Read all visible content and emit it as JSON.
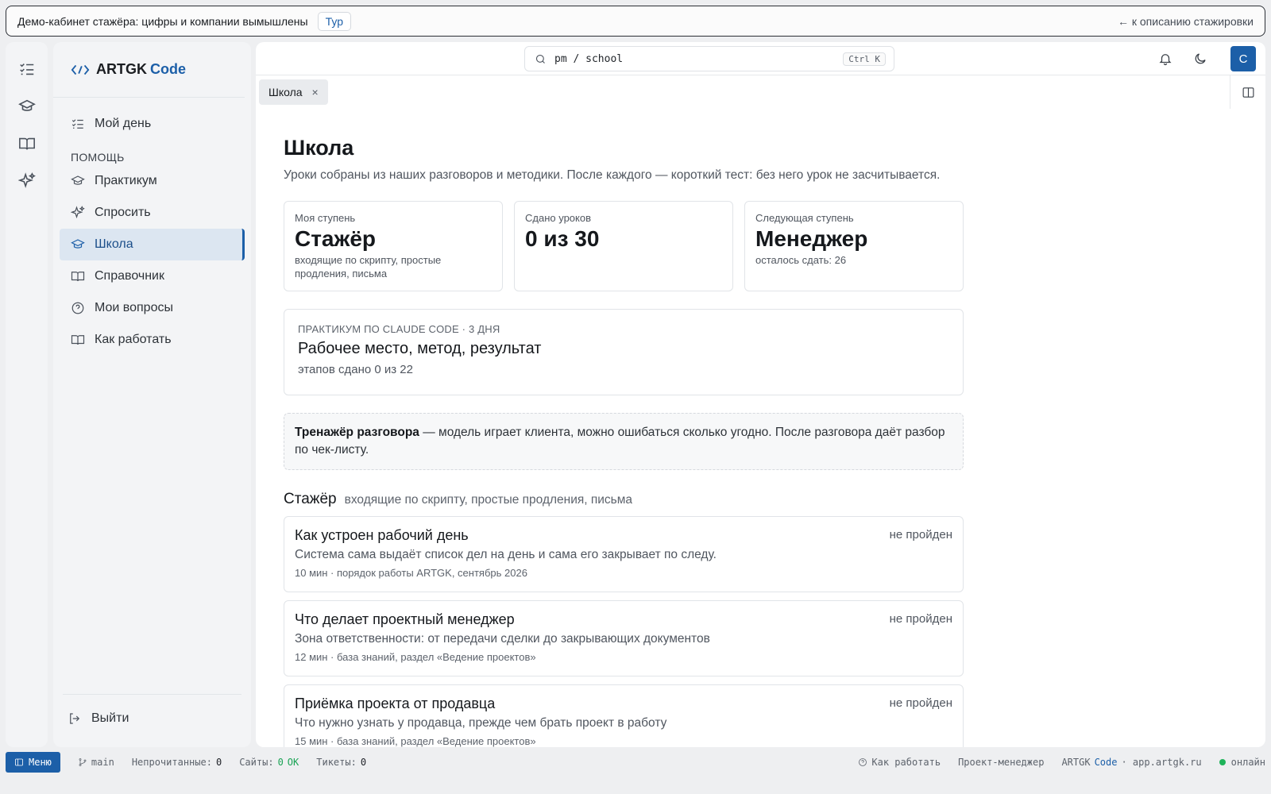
{
  "banner": {
    "text": "Демо-кабинет стажёра: цифры и компании вымышлены",
    "tour": "Тур",
    "back": "← к описанию стажировки"
  },
  "brand": {
    "name": "ARTGK",
    "accent": "Code",
    "color": "#1c5fa8"
  },
  "sidebar": {
    "my_day": "Мой день",
    "section": "ПОМОЩЬ",
    "items": [
      {
        "label": "Практикум",
        "icon": "graduation-cap-icon"
      },
      {
        "label": "Спросить",
        "icon": "sparkles-icon"
      },
      {
        "label": "Школа",
        "icon": "graduation-cap-icon",
        "active": true
      },
      {
        "label": "Справочник",
        "icon": "book-open-icon"
      },
      {
        "label": "Мои вопросы",
        "icon": "question-circle-icon"
      },
      {
        "label": "Как работать",
        "icon": "book-open-icon"
      }
    ],
    "logout": "Выйти"
  },
  "search": {
    "value": "pm / school",
    "shortcut": "Ctrl K"
  },
  "user": {
    "initial": "С"
  },
  "tab": {
    "label": "Школа",
    "close": "×"
  },
  "page": {
    "title": "Школа",
    "subtitle": "Уроки собраны из наших разговоров и методики. После каждого — короткий тест: без него урок не засчитывается."
  },
  "stats": [
    {
      "label": "Моя ступень",
      "value": "Стажёр",
      "desc": "входящие по скрипту, простые продления, письма"
    },
    {
      "label": "Сдано уроков",
      "value": "0 из 30",
      "desc": ""
    },
    {
      "label": "Следующая ступень",
      "value": "Менеджер",
      "desc": "осталось сдать: 26"
    }
  ],
  "course": {
    "eyebrow": "ПРАКТИКУМ ПО CLAUDE CODE · 3 ДНЯ",
    "title": "Рабочее место, метод, результат",
    "progress": "этапов сдано 0 из 22"
  },
  "trainer": {
    "bold": "Тренажёр разговора",
    "rest": " — модель играет клиента, можно ошибаться сколько угодно. После разговора даёт разбор по чек-листу."
  },
  "level": {
    "name": "Стажёр",
    "desc": "входящие по скрипту, простые продления, письма"
  },
  "lessons": [
    {
      "title": "Как устроен рабочий день",
      "desc": "Система сама выдаёт список дел на день и сама его закрывает по следу.",
      "meta": "10 мин · порядок работы ARTGK, сентябрь 2026",
      "status": "не пройден"
    },
    {
      "title": "Что делает проектный менеджер",
      "desc": "Зона ответственности: от передачи сделки до закрывающих документов",
      "meta": "12 мин · база знаний, раздел «Ведение проектов»",
      "status": "не пройден"
    },
    {
      "title": "Приёмка проекта от продавца",
      "desc": "Что нужно узнать у продавца, прежде чем брать проект в работу",
      "meta": "15 мин · база знаний, раздел «Ведение проектов»",
      "status": "не пройден"
    }
  ],
  "statusbar": {
    "menu": "Меню",
    "branch": "main",
    "unread_label": "Непрочитанные:",
    "unread": "0",
    "sites_label": "Сайты:",
    "sites_count": "0",
    "sites_ok": "OK",
    "tickets_label": "Тикеты:",
    "tickets": "0",
    "how": "Как работать",
    "role": "Проект-менеджер",
    "brand": "ARTGK",
    "brand_accent": "Code",
    "domain": "· app.artgk.ru",
    "online": "онлайн"
  }
}
